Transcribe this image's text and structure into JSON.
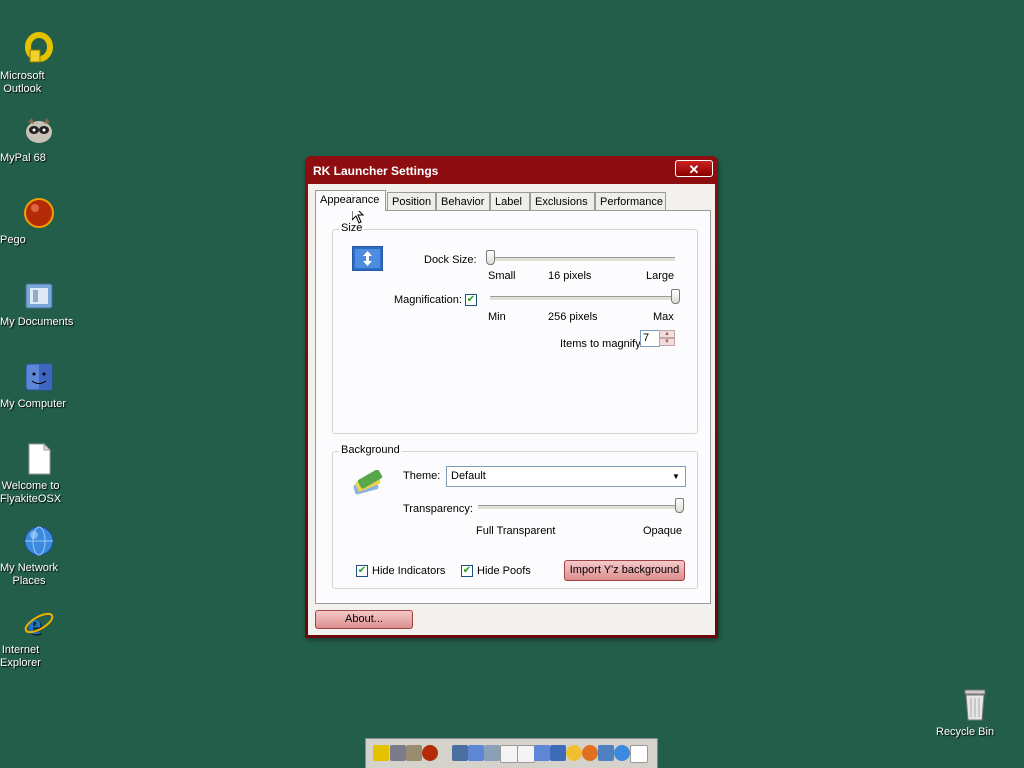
{
  "desktop": {
    "icons": [
      {
        "label": "Microsoft\nOutlook",
        "icon": "outlook-icon"
      },
      {
        "label": "MyPal 68",
        "icon": "mypal-icon"
      },
      {
        "label": "Pego",
        "icon": "pego-icon"
      },
      {
        "label": "My Documents",
        "icon": "documents-folder-icon"
      },
      {
        "label": "My Computer",
        "icon": "computer-icon"
      },
      {
        "label": "Welcome to\nFlyakiteOSX",
        "icon": "document-icon"
      },
      {
        "label": "My Network\nPlaces",
        "icon": "network-globe-icon"
      },
      {
        "label": "Internet\nExplorer",
        "icon": "ie-icon"
      },
      {
        "label": "Recycle Bin",
        "icon": "recycle-bin-icon"
      }
    ]
  },
  "window": {
    "title": "RK Launcher Settings",
    "close_label": "✕",
    "tabs": [
      "Appearance",
      "Position",
      "Behavior",
      "Label",
      "Exclusions",
      "Performance"
    ],
    "active_tab": "Appearance",
    "size_group": {
      "title": "Size",
      "dock_size_label": "Dock Size:",
      "dock_min": "Small",
      "dock_value": "16 pixels",
      "dock_max": "Large",
      "dock_size_position": 0.0,
      "magnification_label": "Magnification:",
      "magnification_checked": true,
      "mag_min": "Min",
      "mag_value": "256 pixels",
      "mag_max": "Max",
      "magnification_position": 1.0,
      "items_label": "Items to magnify:",
      "items_value": "7"
    },
    "background_group": {
      "title": "Background",
      "theme_label": "Theme:",
      "theme_value": "Default",
      "transparency_label": "Transparency:",
      "transparency_min": "Full Transparent",
      "transparency_max": "Opaque",
      "transparency_position": 1.0,
      "hide_indicators_label": "Hide Indicators",
      "hide_indicators_checked": true,
      "hide_poofs_label": "Hide Poofs",
      "hide_poofs_checked": true,
      "import_button": "Import Y'z background"
    },
    "about_button": "About..."
  },
  "colors": {
    "desktop": "#235e4a",
    "title_bar": "#8e0d10",
    "accent_button": "#e8aaaa"
  }
}
